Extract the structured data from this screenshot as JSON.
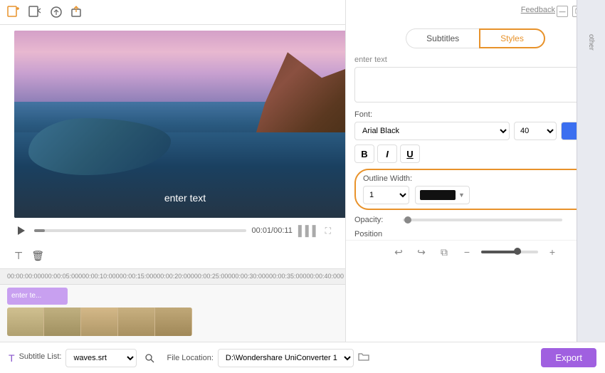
{
  "app": {
    "feedback_label": "Feedback",
    "other_label": "other"
  },
  "window_controls": {
    "minimize": "—",
    "restore": "❐",
    "close": "✕"
  },
  "toolbar": {
    "icons": [
      "new-project",
      "import",
      "capture",
      "export-small"
    ]
  },
  "tabs": {
    "subtitles_label": "Subtitles",
    "styles_label": "Styles",
    "active": "styles"
  },
  "text_input": {
    "label": "enter text",
    "placeholder": "enter text"
  },
  "font": {
    "label": "Font:",
    "font_name": "Arial Black",
    "size": "40",
    "bold": "B",
    "italic": "I",
    "underline": "U"
  },
  "outline": {
    "label": "Outline Width:",
    "size": "1",
    "color_label": "black"
  },
  "opacity": {
    "label": "Opacity:",
    "value": "0/100"
  },
  "position": {
    "label": "Position"
  },
  "bottom_controls": {
    "undo": "↩",
    "redo": "↪",
    "copy": "⧉",
    "zoom_out": "−",
    "zoom_in": "+"
  },
  "video": {
    "overlay_text": "enter text",
    "time": "00:01/00:11",
    "start_time": "00:00:00:000"
  },
  "timeline": {
    "marks": [
      "00:00:00:000",
      "00:00:05:000",
      "00:00:10:000",
      "00:00:15:000",
      "00:00:20:000",
      "00:00:25:000",
      "00:00:30:000",
      "00:00:35:000",
      "00:00:40:000"
    ]
  },
  "subtitle_track": {
    "text": "enter te..."
  },
  "footer": {
    "subtitle_label": "Subtitle List:",
    "subtitle_file": "waves.srt",
    "file_location_label": "File Location:",
    "file_path": "D:\\Wondershare UniConverter 1",
    "export_label": "Export"
  }
}
